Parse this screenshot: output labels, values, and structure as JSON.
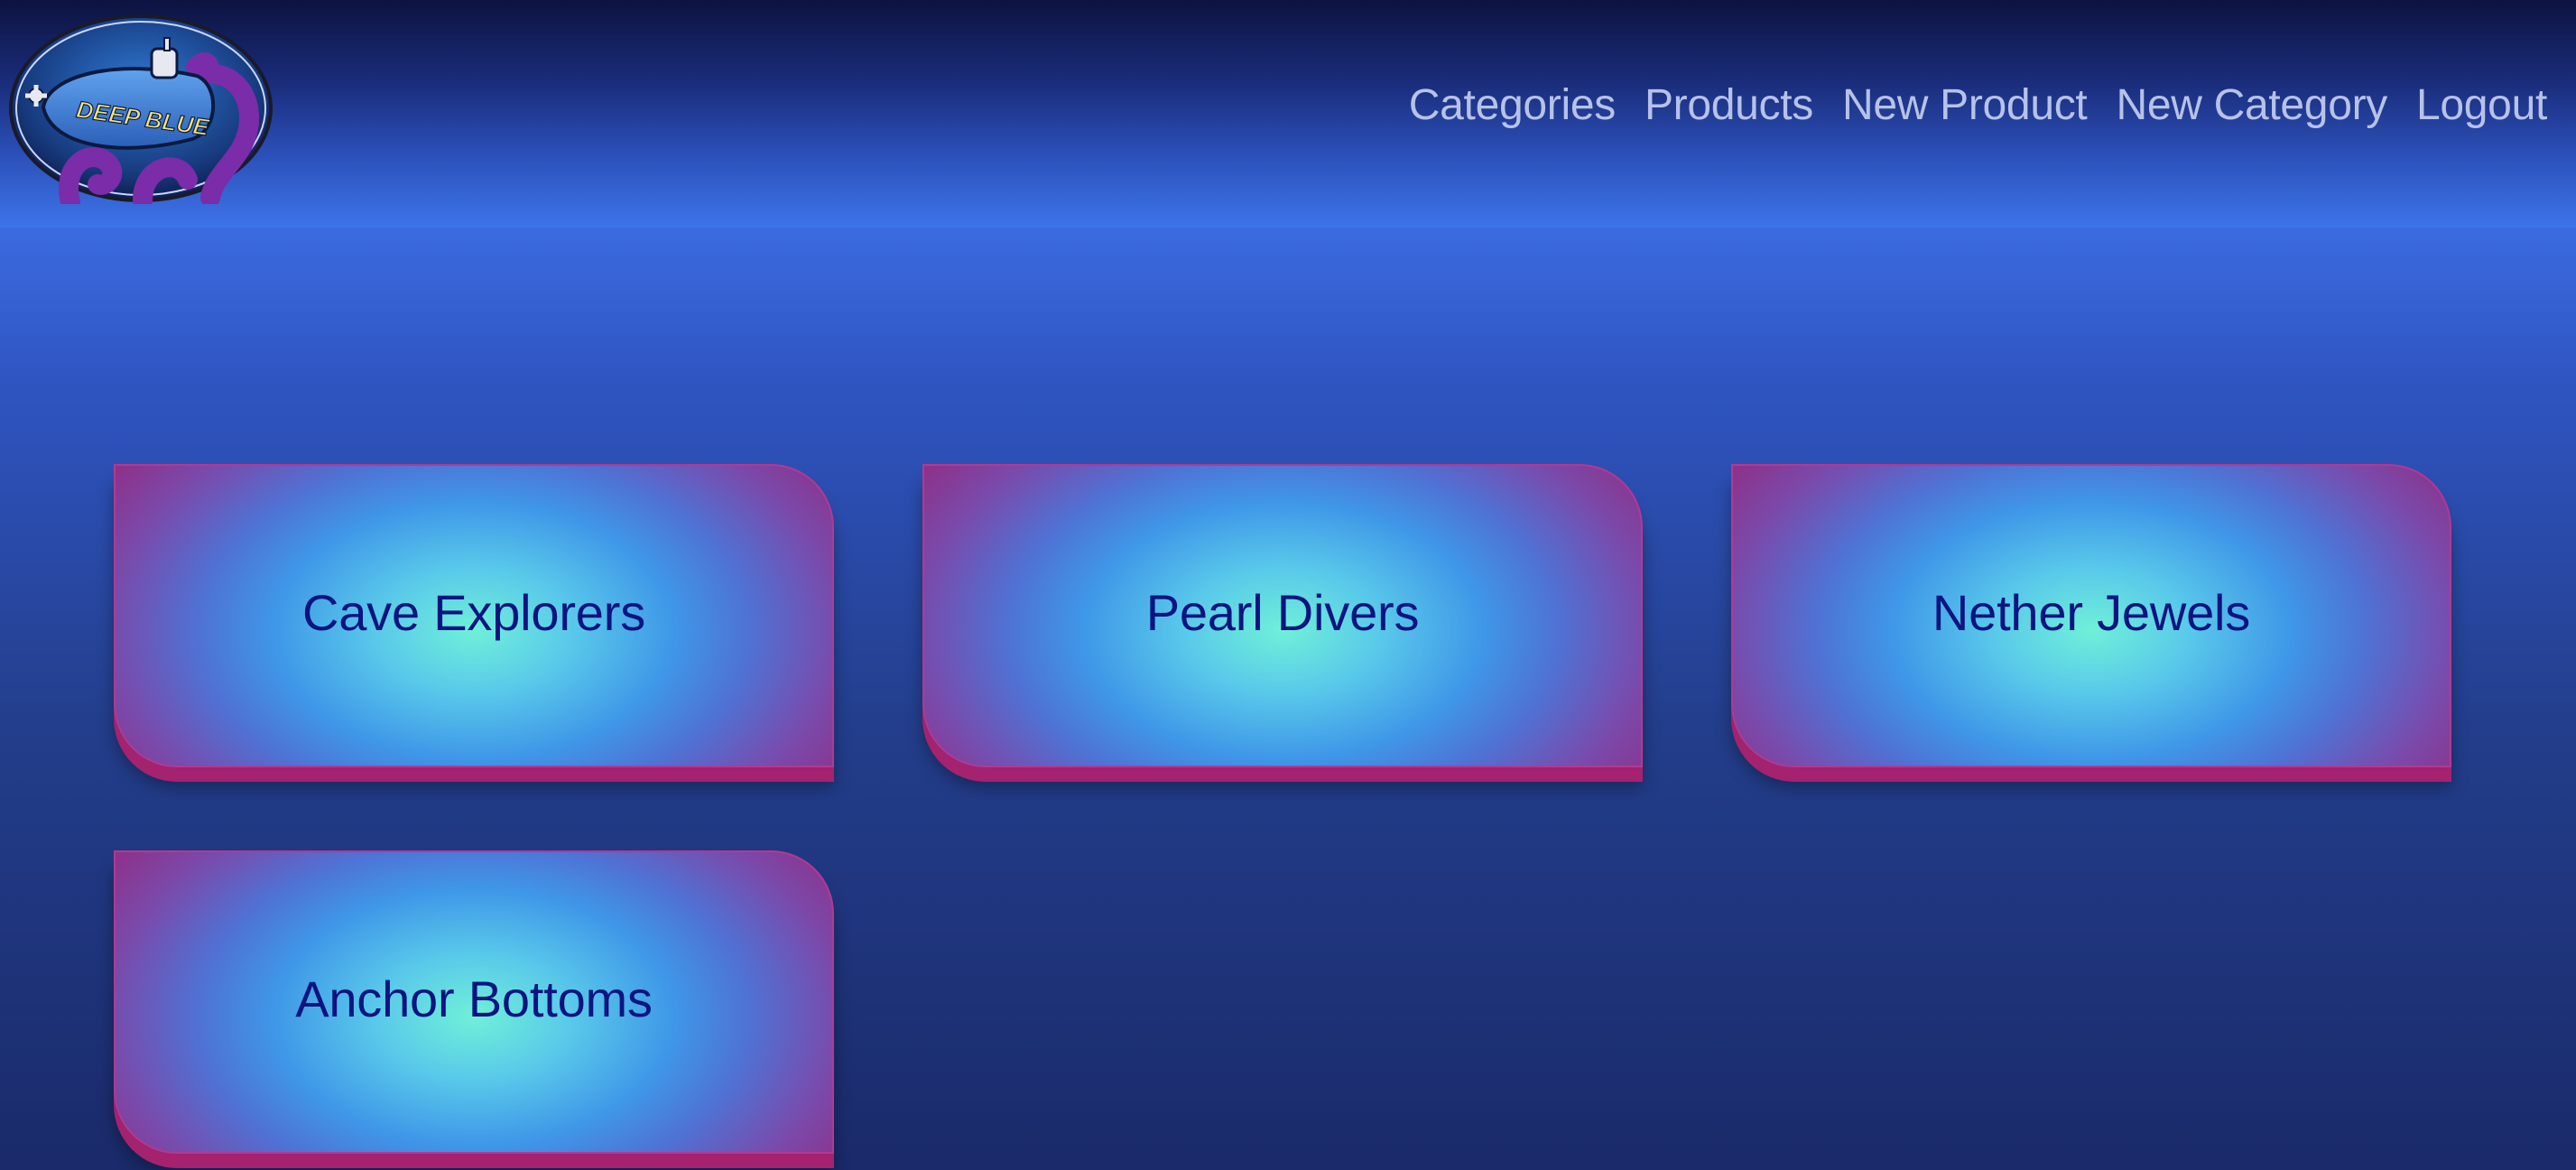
{
  "brand": {
    "logo_text": "DEEP BLUE",
    "colors": {
      "navy": "#0d1340",
      "purple": "#8f2f86",
      "accent_blue": "#3d74ea"
    }
  },
  "nav": {
    "items": [
      {
        "label": "Categories"
      },
      {
        "label": "Products"
      },
      {
        "label": "New Product"
      },
      {
        "label": "New Category"
      },
      {
        "label": "Logout"
      }
    ]
  },
  "categories": [
    {
      "name": "Cave Explorers"
    },
    {
      "name": "Pearl Divers"
    },
    {
      "name": "Nether Jewels"
    },
    {
      "name": "Anchor Bottoms"
    }
  ]
}
